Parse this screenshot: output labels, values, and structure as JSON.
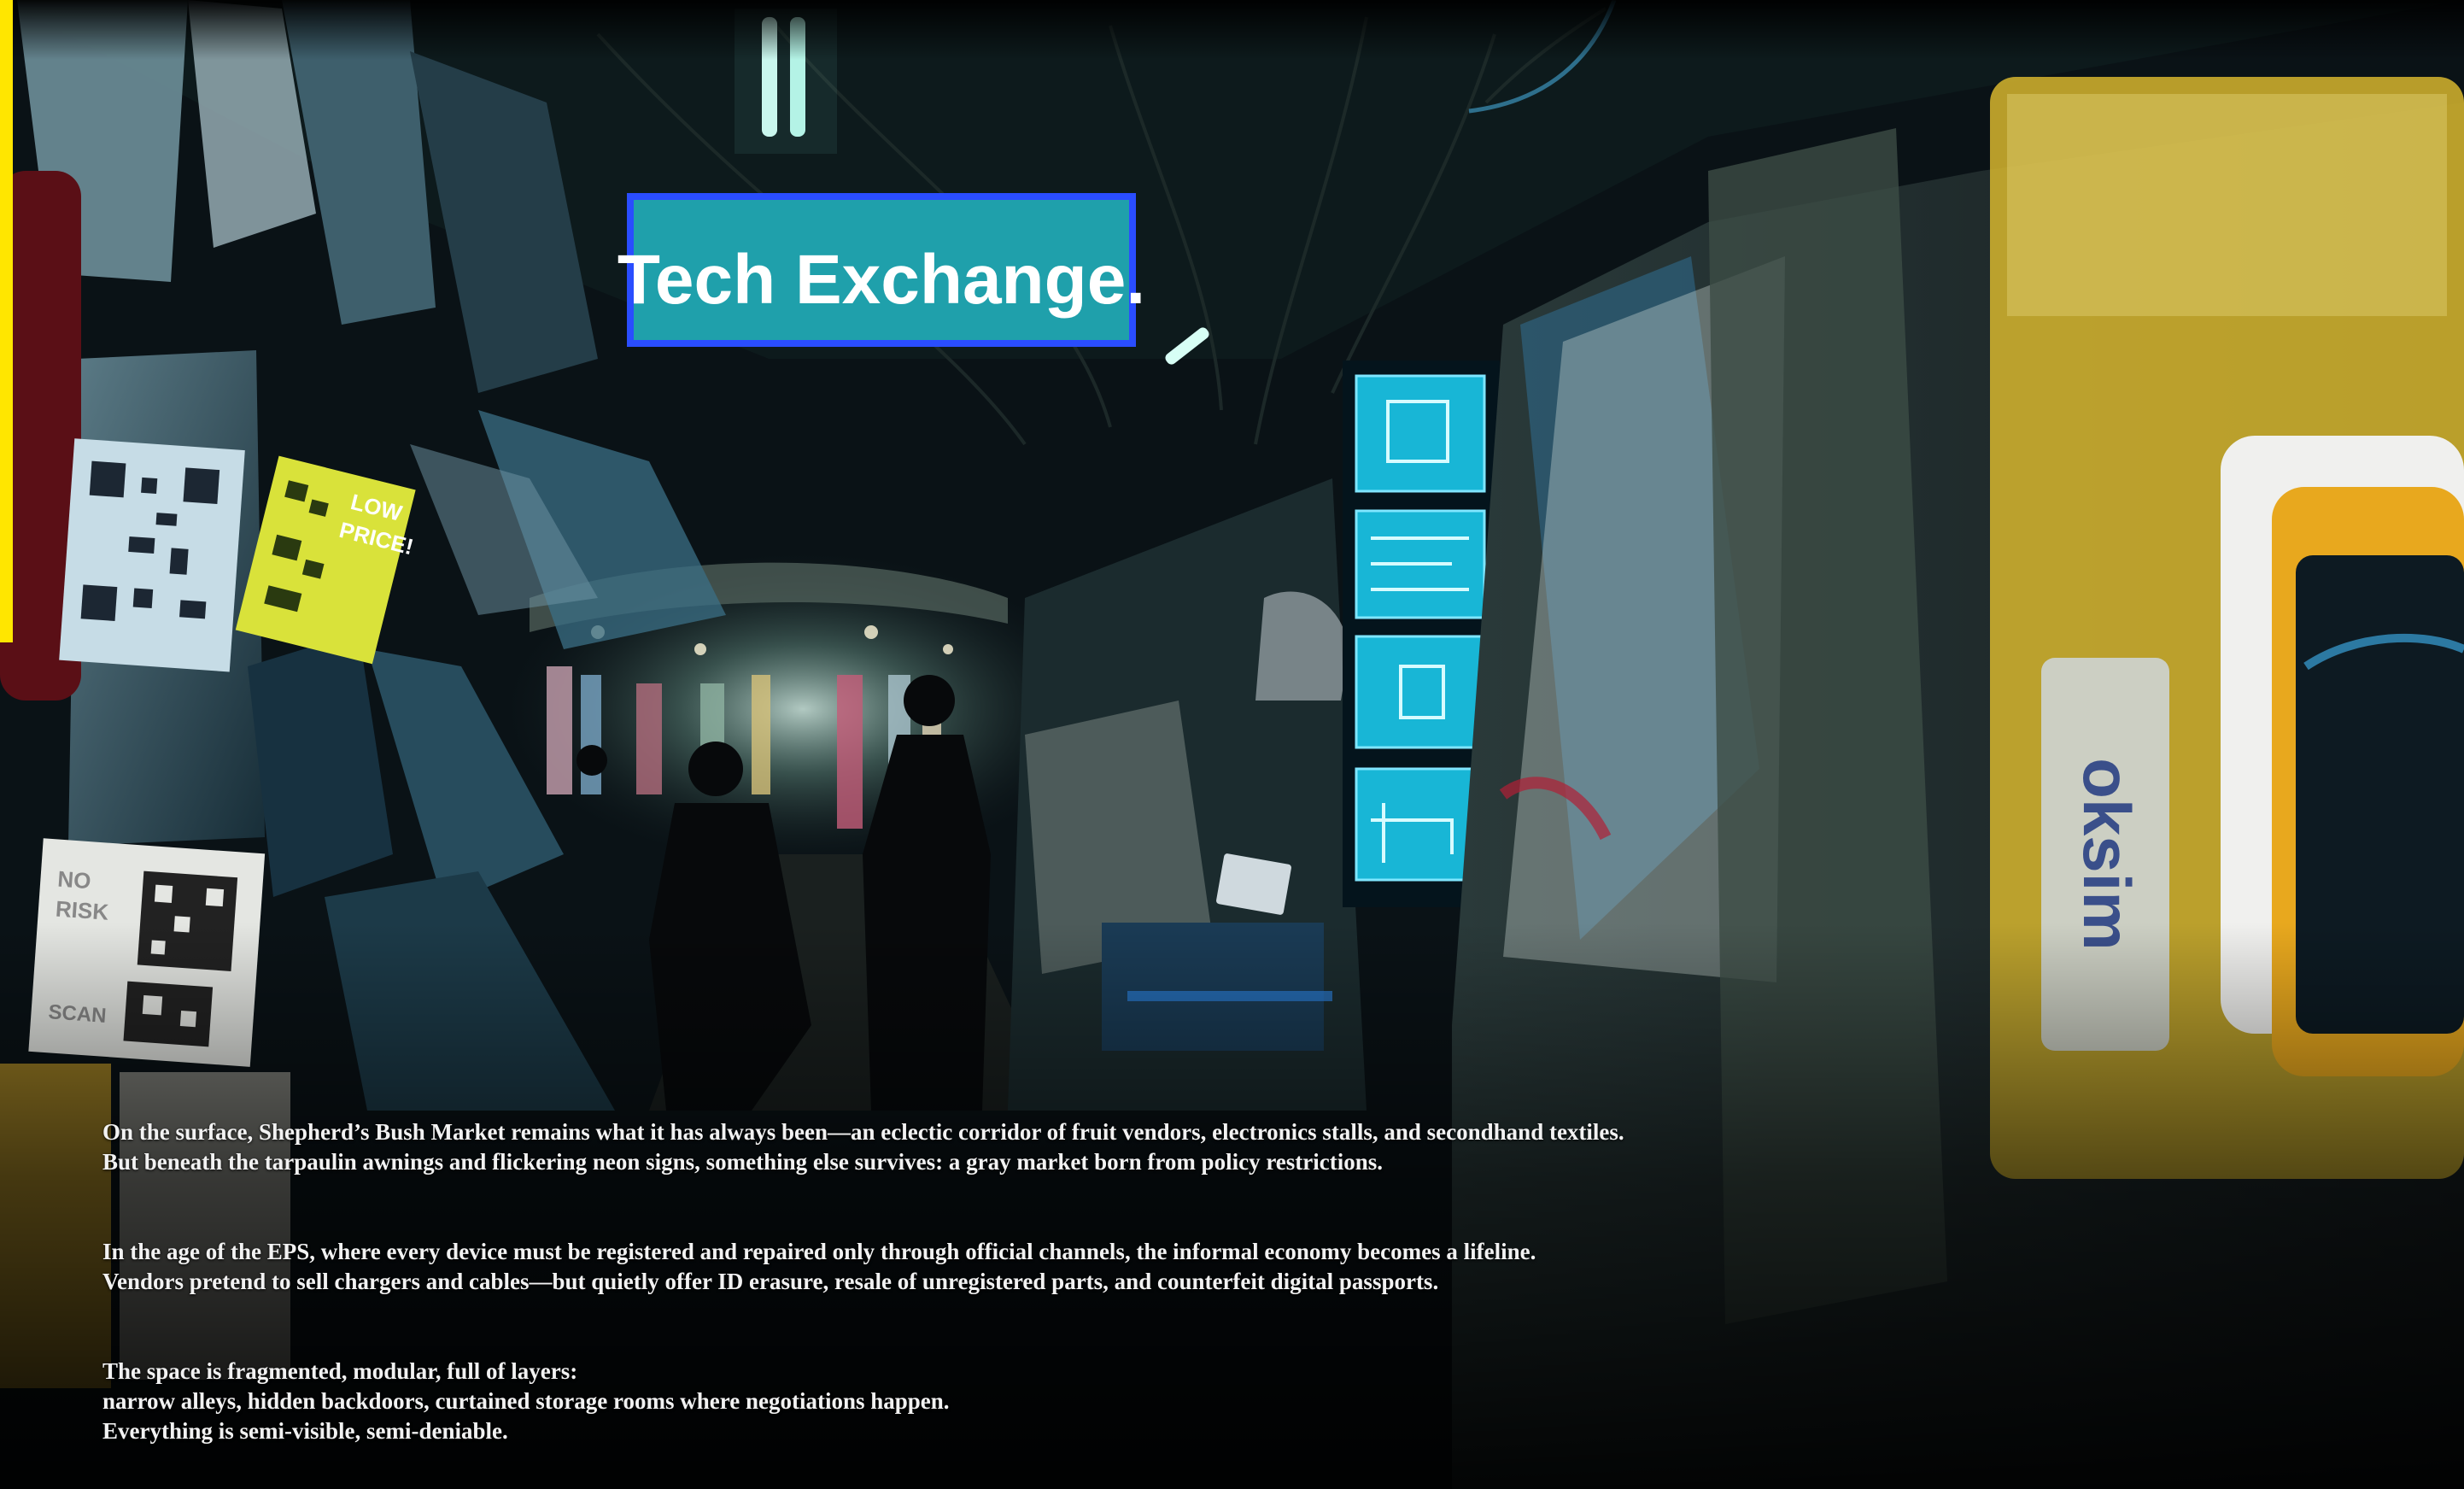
{
  "scene": {
    "sign_text": "Tech Exchange.",
    "poster_1_text": "LOW PRICE!",
    "poster_2_text": "NO RISK SCAN",
    "brand_card_text": "oksim",
    "colors": {
      "accent": "#ffe600",
      "neon_sign": "#1fa0ab",
      "neon_border": "#2a4dff",
      "screens": "#18b6d6",
      "yellow_poster": "#d9e23a",
      "yellow_card": "#d7b62e"
    }
  },
  "caption": {
    "paragraphs": [
      {
        "lines": [
          "On the surface, Shepherd’s Bush Market remains what it has always been—an eclectic corridor of fruit vendors, electronics stalls, and secondhand textiles.",
          "But beneath the tarpaulin awnings and flickering neon signs, something else survives: a gray market born from policy restrictions."
        ]
      },
      {
        "lines": [
          "In the age of the EPS, where every device must be registered and repaired only through official channels, the informal economy becomes a lifeline.",
          "Vendors pretend to sell chargers and cables—but quietly offer ID erasure, resale of unregistered parts, and counterfeit digital passports."
        ]
      },
      {
        "lines": [
          "The space is fragmented, modular, full of layers:",
          "narrow alleys, hidden backdoors, curtained storage rooms where negotiations happen.",
          "Everything is semi-visible, semi-deniable."
        ]
      }
    ]
  }
}
